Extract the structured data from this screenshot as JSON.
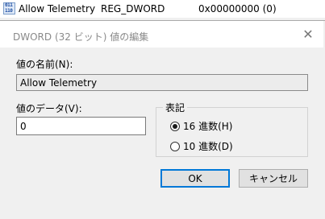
{
  "registry_row": {
    "icon": "reg-dword-icon",
    "icon_text": "011\n110",
    "name": "Allow Telemetry",
    "type": "REG_DWORD",
    "data": "0x00000000 (0)"
  },
  "dialog": {
    "title": "DWORD (32 ビット) 値の編集",
    "close_icon": "close-icon",
    "value_name_label": "値の名前(N):",
    "value_name": "Allow Telemetry",
    "value_data_label": "値のデータ(V):",
    "value_data": "0",
    "base_group_label": "表記",
    "base_options": [
      {
        "label": "16 進数(H)",
        "checked": true
      },
      {
        "label": "10 進数(D)",
        "checked": false
      }
    ],
    "ok_label": "OK",
    "cancel_label": "キャンセル"
  },
  "colors": {
    "dialog_bg": "#f0f0f0",
    "title_text": "#8a8a8a",
    "default_button_border": "#0078d7"
  }
}
